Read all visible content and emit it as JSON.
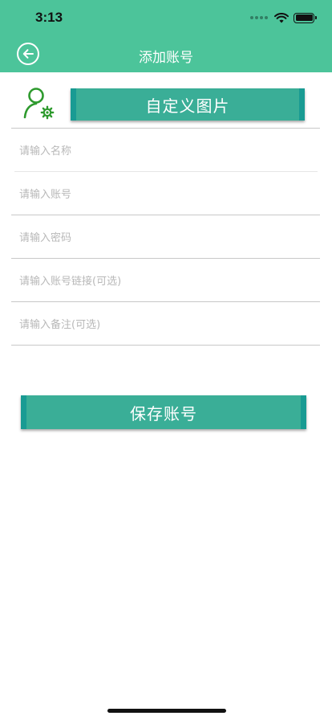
{
  "status_bar": {
    "time": "3:13"
  },
  "nav": {
    "title": "添加账号",
    "back_icon": "arrow-left-circle-icon"
  },
  "avatar": {
    "icon": "user-settings-icon",
    "color": "#2e9a2e"
  },
  "custom_image_button": {
    "label": "自定义图片"
  },
  "form": {
    "name_placeholder": "请输入名称",
    "account_placeholder": "请输入账号",
    "password_placeholder": "请输入密码",
    "link_placeholder": "请输入账号链接(可选)",
    "note_placeholder": "请输入备注(可选)"
  },
  "save_button": {
    "label": "保存账号"
  },
  "colors": {
    "header": "#4cc49a",
    "button": "#3aae97",
    "button_edge": "#199b93"
  }
}
